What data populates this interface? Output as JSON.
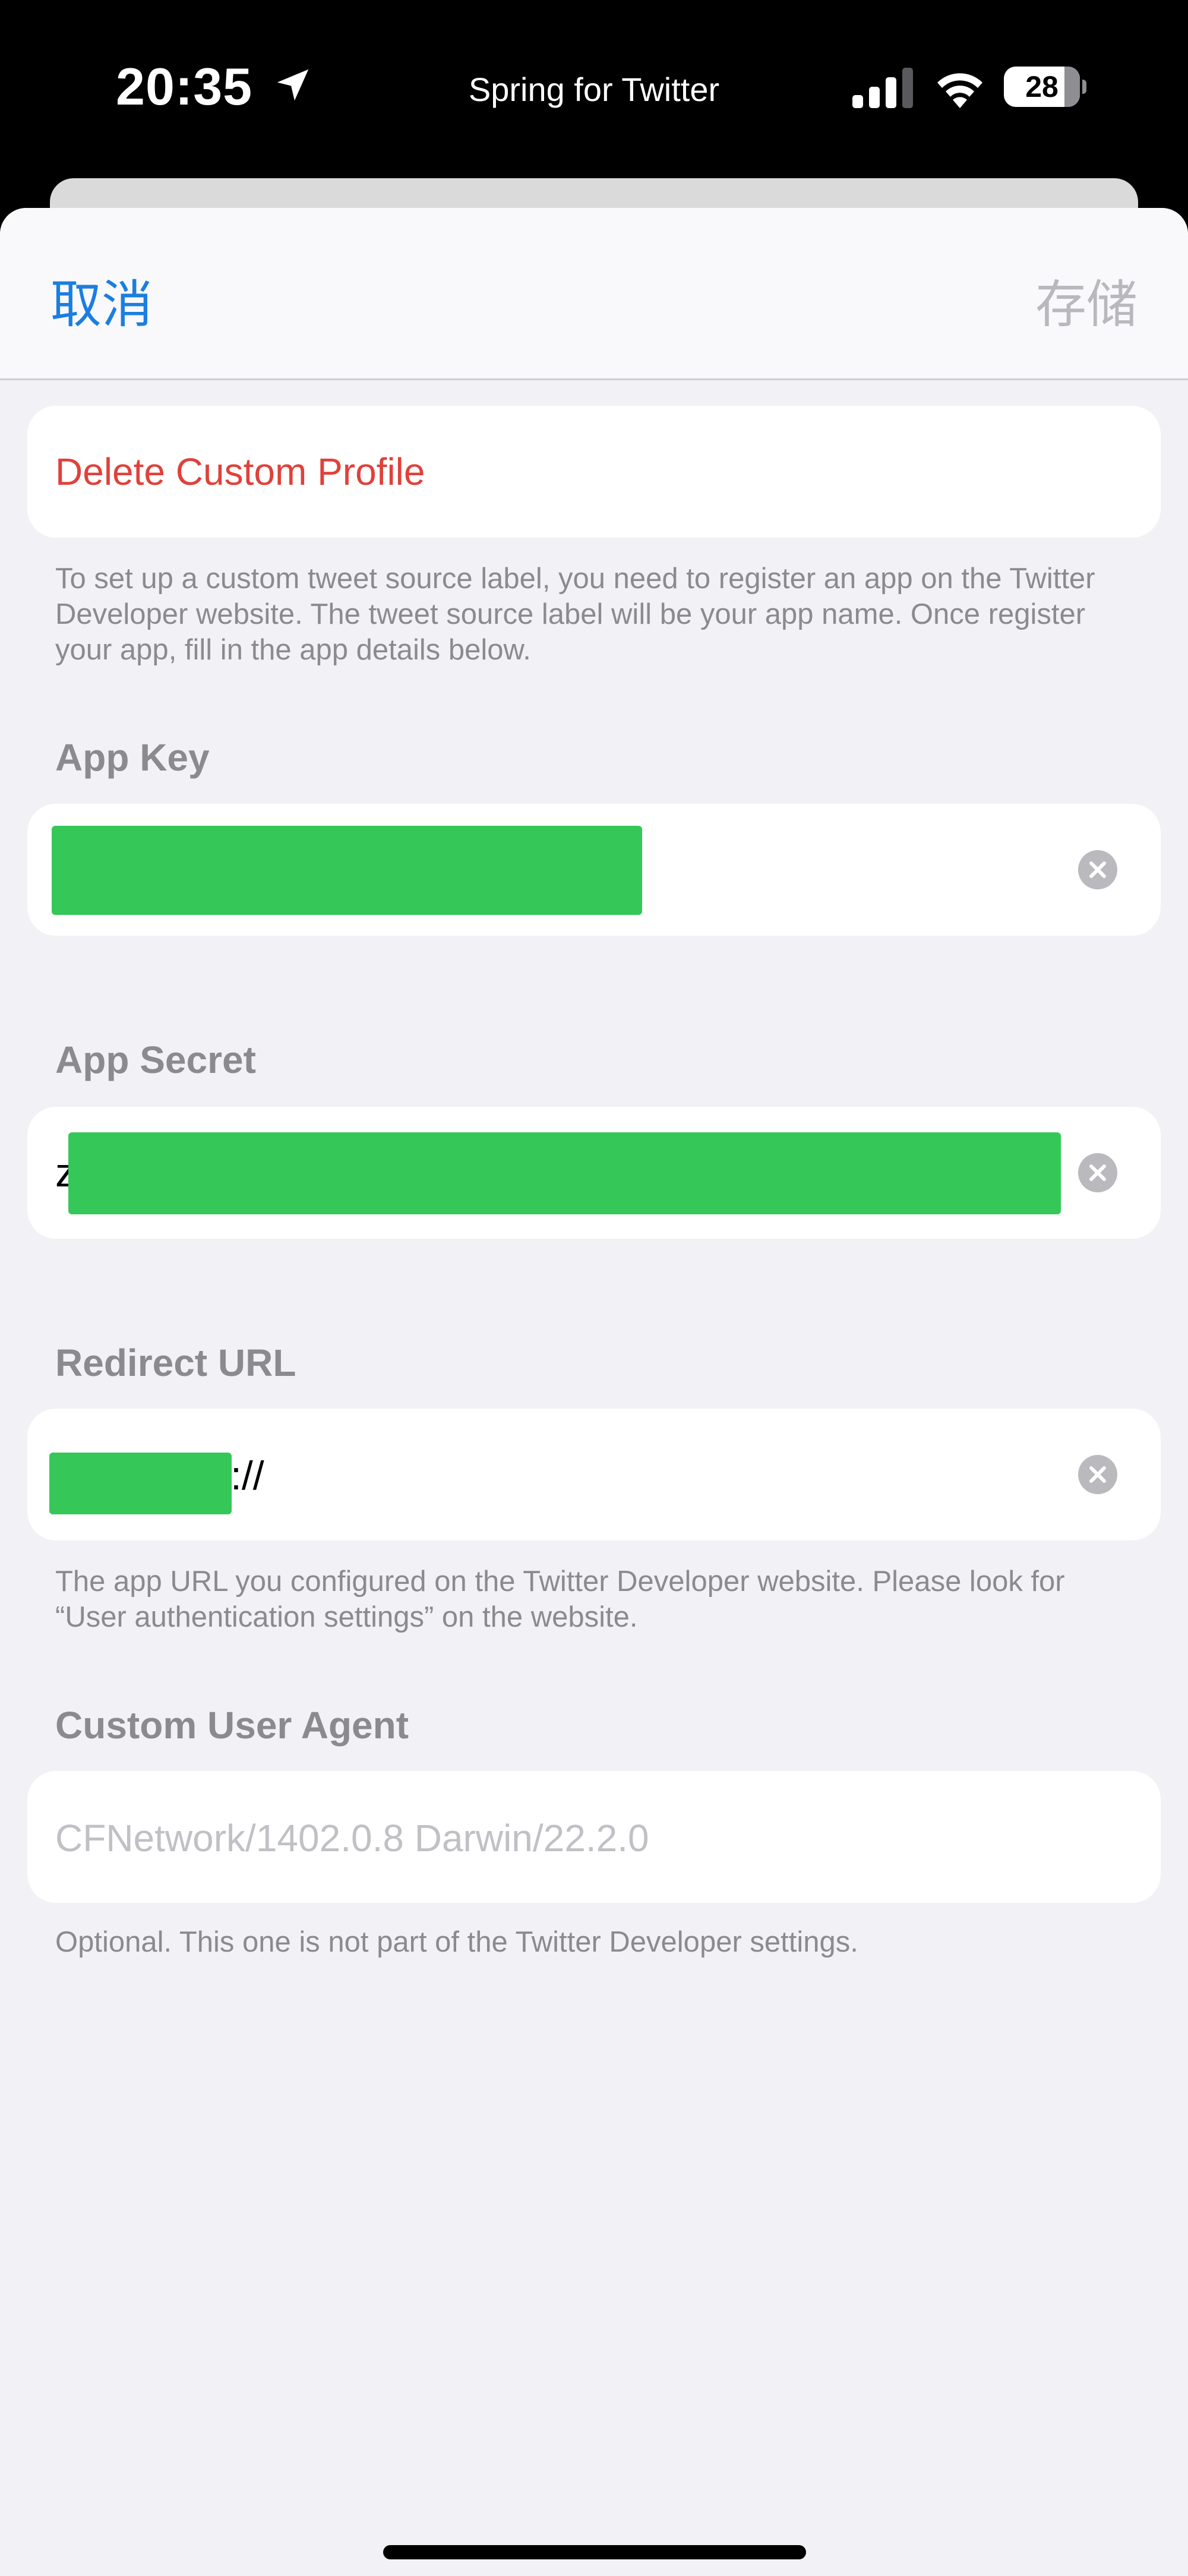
{
  "status_bar": {
    "time": "20:35",
    "app_name": "Spring for Twitter",
    "battery_level": "28",
    "battery_fraction": 0.28
  },
  "navbar": {
    "cancel_label": "取消",
    "save_label": "存储"
  },
  "delete_profile": {
    "label": "Delete Custom Profile",
    "footnote": "To set up a custom tweet source label, you need to register an app on the Twitter Developer website. The tweet source label will be your app name. Once register your app, fill in the app details below."
  },
  "app_key": {
    "header": "App Key"
  },
  "app_secret": {
    "header": "App Secret",
    "visible_prefix": "z"
  },
  "redirect_url": {
    "header": "Redirect URL",
    "visible_suffix": "://",
    "footnote": "The app URL you configured on the Twitter Developer website. Please look for “User authentication settings” on the website."
  },
  "user_agent": {
    "header": "Custom User Agent",
    "placeholder": "CFNetwork/1402.0.8 Darwin/22.2.0",
    "footnote": "Optional. This one is not part of the Twitter Developer settings."
  },
  "colors": {
    "accent": "#1b7ee0",
    "destructive": "#e0413b",
    "redaction": "#36c759",
    "secondary_text": "#8a8a8f"
  },
  "icons": [
    "location-arrow-icon",
    "cellular-signal-icon",
    "wifi-icon",
    "battery-icon",
    "clear-circle-icon"
  ]
}
